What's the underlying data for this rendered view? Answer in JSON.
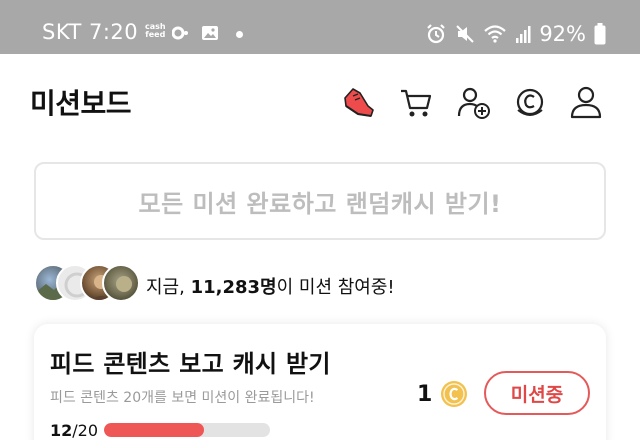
{
  "status_bar": {
    "carrier_time": "SKT 7:20",
    "cashfeed_line1": "cash",
    "cashfeed_line2": "feed",
    "battery": "92%",
    "icons": [
      "cashfeed-icon",
      "notification-dot-icon",
      "gallery-icon",
      "alarm-icon",
      "mute-icon",
      "wifi-icon",
      "signal-icon",
      "battery-icon"
    ]
  },
  "header": {
    "title": "미션보드",
    "icons": [
      "sneaker-icon",
      "cart-icon",
      "add-friend-icon",
      "coin-icon",
      "profile-icon"
    ]
  },
  "banner": {
    "text": "모든 미션 완료하고 랜덤캐시 받기!"
  },
  "participants": {
    "prefix": "지금, ",
    "count": "11,283명",
    "suffix": "이 미션 참여중!"
  },
  "mission": {
    "title": "피드 콘텐츠 보고 캐시 받기",
    "description": "피드 콘텐츠 20개를 보면 미션이 완료됩니다!",
    "reward": "1",
    "reward_icon": "coin-icon",
    "button_label": "미션중",
    "progress_current": "12",
    "progress_sep": "/",
    "progress_total": "20",
    "progress_fraction": 0.6
  },
  "colors": {
    "accent_red": "#e04848",
    "progress_fill": "#ef5757",
    "coin_gold": "#f2c14e"
  }
}
